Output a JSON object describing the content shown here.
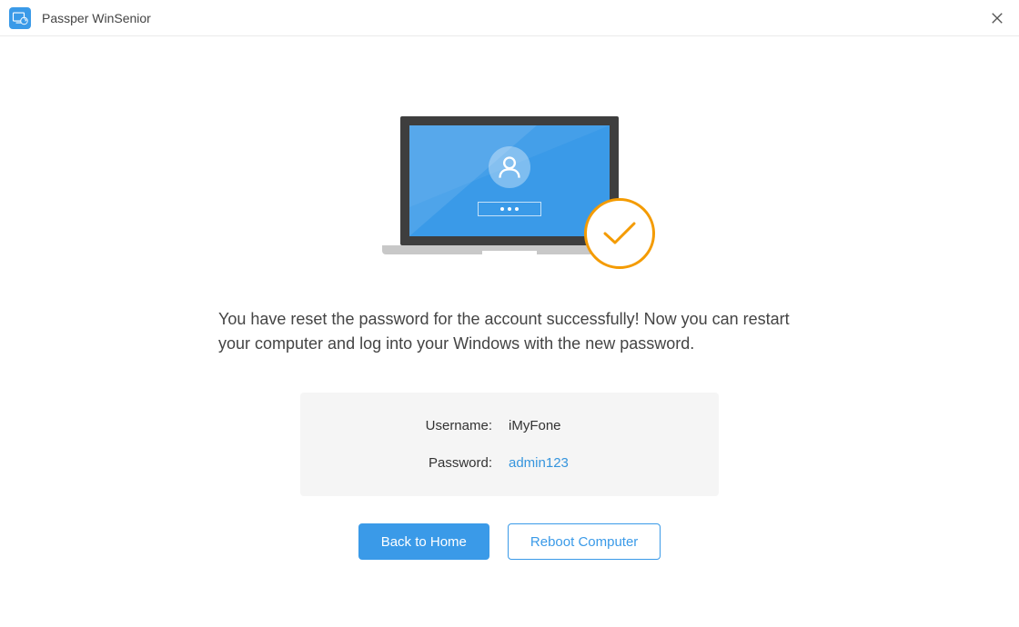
{
  "header": {
    "title": "Passper WinSenior"
  },
  "main": {
    "message": "You have reset the password for the account successfully! Now you can restart your computer and log into your Windows with the new password.",
    "credentials": {
      "username_label": "Username:",
      "username_value": "iMyFone",
      "password_label": "Password:",
      "password_value": "admin123"
    },
    "buttons": {
      "back_home": "Back to Home",
      "reboot": "Reboot Computer"
    }
  },
  "colors": {
    "accent": "#3a9ae8",
    "success": "#f49b00"
  }
}
